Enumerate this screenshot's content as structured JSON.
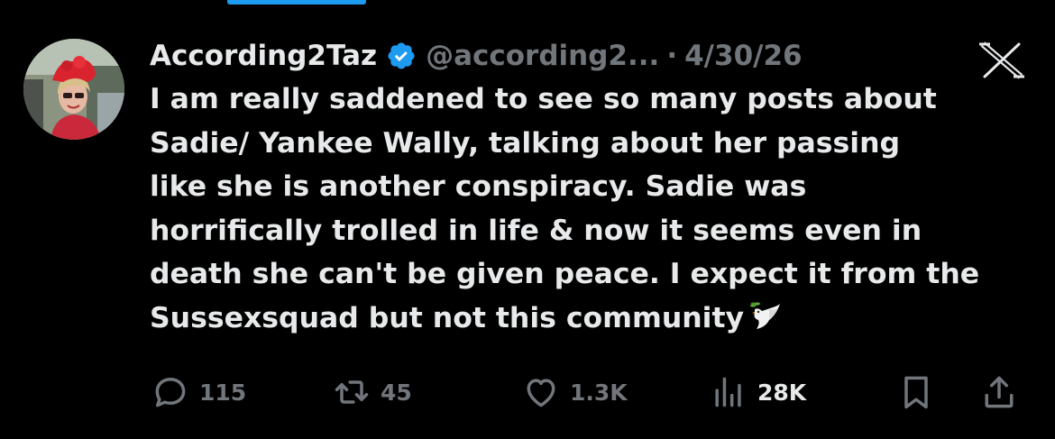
{
  "tweet": {
    "display_name": "According2Taz",
    "handle": "@according2...",
    "separator": "·",
    "date": "4/30/26",
    "text": "I am really saddened to see so many posts about\nSadie/ Yankee Wally, talking about her passing\nlike she is another conspiracy. Sadie was\nhorrifically trolled in life & now it seems even in\ndeath she can't be given peace. I expect it from the\nSussexsquad but not this community"
  },
  "icons": {
    "verified": "verified-badge-icon",
    "platform": "x-logo-icon",
    "emoji": "dove-emoji-icon"
  },
  "actions": {
    "replies": "115",
    "reposts": "45",
    "likes": "1.3K",
    "views": "28K"
  },
  "colors": {
    "background": "#000000",
    "primary_text": "#e7e9ea",
    "secondary_text": "#71767b",
    "accent": "#1d9bf0"
  }
}
